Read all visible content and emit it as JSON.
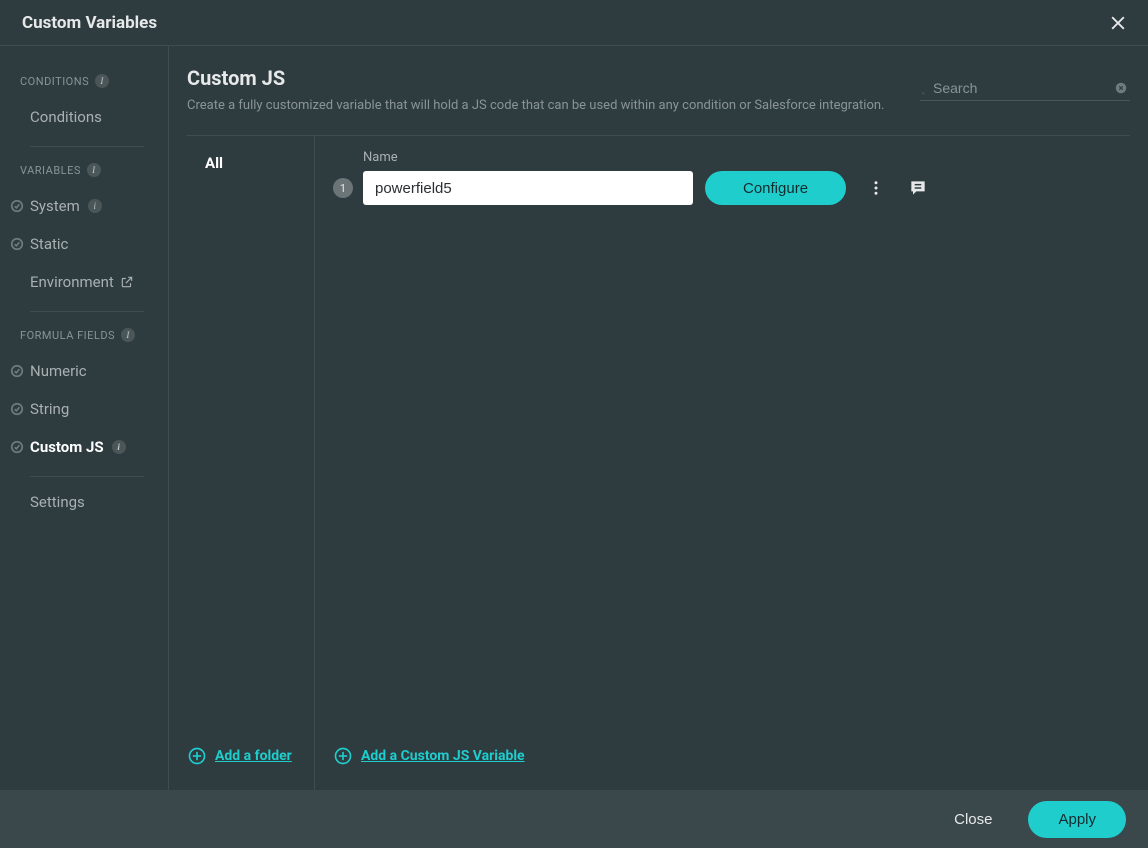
{
  "modal": {
    "title": "Custom Variables"
  },
  "sidebar": {
    "groups": {
      "conditions": {
        "header": "CONDITIONS",
        "items": {
          "0": {
            "label": "Conditions"
          }
        }
      },
      "variables": {
        "header": "VARIABLES",
        "items": {
          "0": {
            "label": "System"
          },
          "1": {
            "label": "Static"
          },
          "2": {
            "label": "Environment"
          }
        }
      },
      "formula": {
        "header": "FORMULA FIELDS",
        "items": {
          "0": {
            "label": "Numeric"
          },
          "1": {
            "label": "String"
          },
          "2": {
            "label": "Custom JS"
          }
        }
      }
    },
    "settings_label": "Settings"
  },
  "main": {
    "heading": "Custom JS",
    "description": "Create a fully customized variable that will hold a JS code that can be used within any condition or Salesforce integration.",
    "search_placeholder": "Search",
    "folders": {
      "0": {
        "label": "All"
      }
    },
    "name_label": "Name",
    "rows": {
      "0": {
        "index": "1",
        "name": "powerfield5",
        "configure_label": "Configure"
      }
    },
    "add_folder_label": "Add a folder",
    "add_variable_label": "Add a Custom JS Variable"
  },
  "footer": {
    "close": "Close",
    "apply": "Apply"
  }
}
